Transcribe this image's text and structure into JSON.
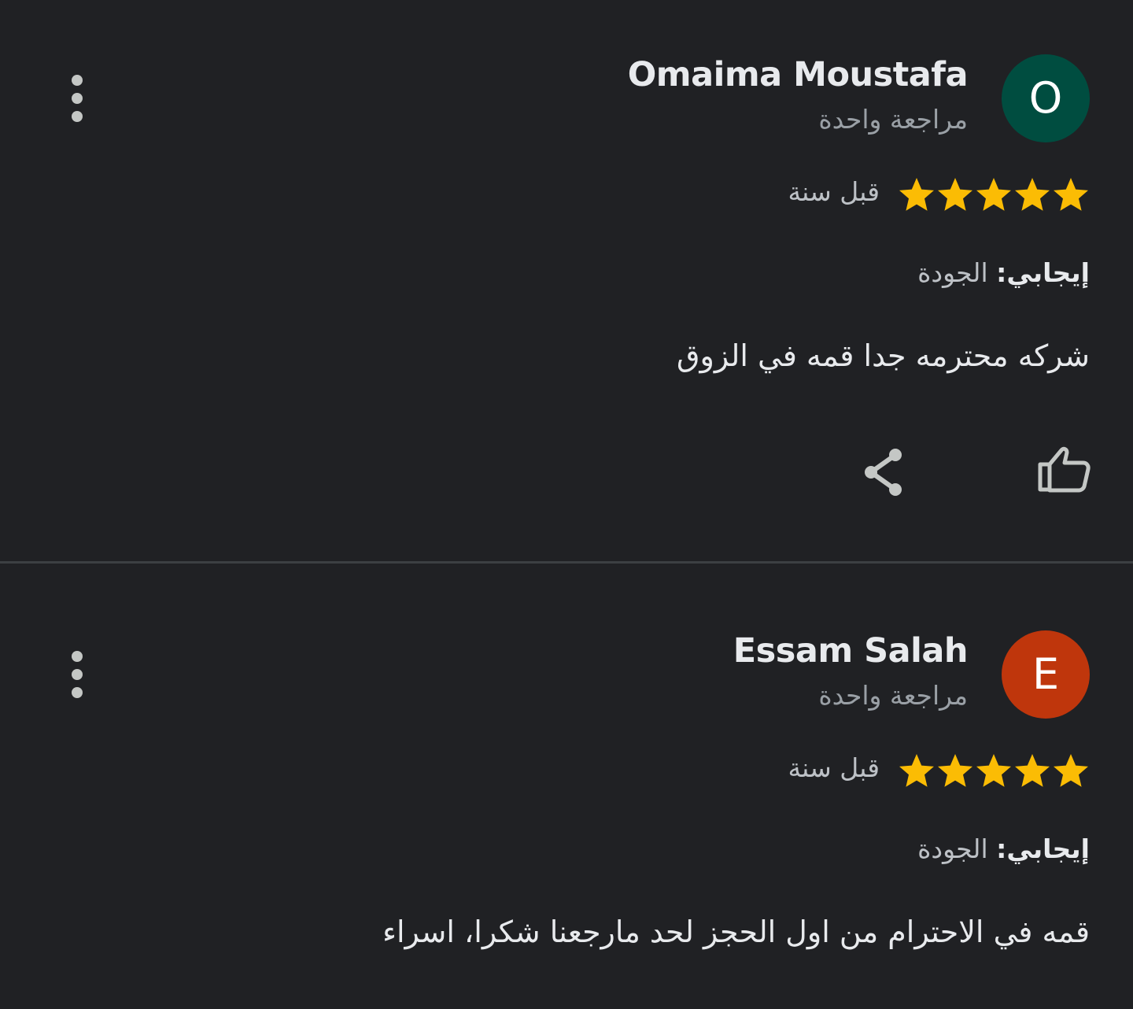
{
  "reviews": [
    {
      "avatar_letter": "O",
      "avatar_color": "#004d40",
      "author": "Omaima Moustafa",
      "review_count": "مراجعة واحدة",
      "rating": 5,
      "time_ago": "قبل سنة",
      "attribute_label": "إيجابي:",
      "attribute_value": "الجودة",
      "text": "شركه محترمه جدا قمه في الزوق",
      "icons": {
        "more": "more-vert-icon",
        "like": "thumb-up-icon",
        "share": "share-icon"
      }
    },
    {
      "avatar_letter": "E",
      "avatar_color": "#bf360c",
      "author": "Essam Salah",
      "review_count": "مراجعة واحدة",
      "rating": 5,
      "time_ago": "قبل سنة",
      "attribute_label": "إيجابي:",
      "attribute_value": "الجودة",
      "text": "قمه في الاحترام من اول الحجز لحد مارجعنا شكرا، اسراء",
      "icons": {
        "more": "more-vert-icon"
      }
    }
  ],
  "colors": {
    "background": "#202124",
    "star": "#fbbc04",
    "text_primary": "#e8eaed",
    "text_secondary": "#9aa0a6",
    "icon": "#c4c7c5",
    "divider": "#3c4043"
  }
}
